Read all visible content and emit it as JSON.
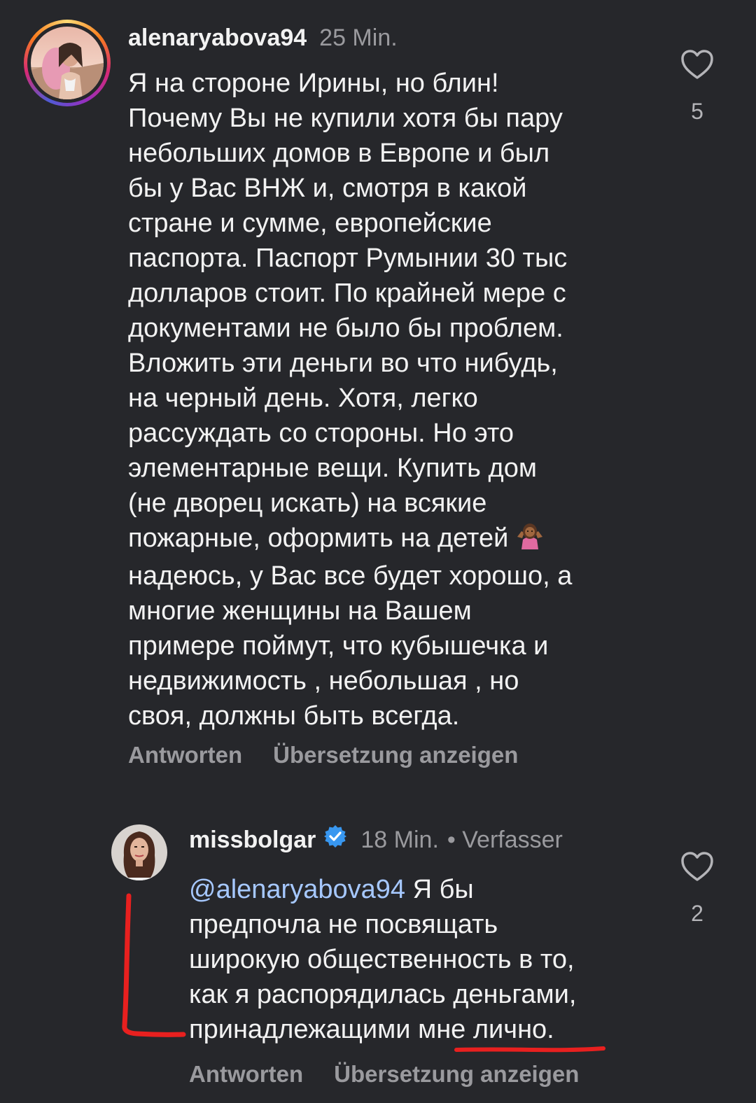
{
  "comments": [
    {
      "username": "alenaryabova94",
      "time": "25 Min.",
      "likes": "5",
      "lines": [
        "Я на стороне Ирины, но блин!",
        "Почему Вы не купили хотя бы пару",
        "небольших домов в Европе и был",
        "бы у Вас ВНЖ и, смотря в какой",
        "стране и сумме, европейские",
        "паспорта. Паспорт Румынии 30 тыс",
        "долларов стоит. По крайней мере с",
        "документами не было бы проблем.",
        "Вложить эти деньги во что нибудь,",
        "на черный день. Хотя, легко",
        "рассуждать со стороны. Но это",
        "элементарные вещи. Купить дом",
        "(не дворец искать) на всякие",
        "пожарные, оформить на детей",
        "надеюсь, у Вас все будет хорошо, а",
        "многие женщины на Вашем",
        "примере поймут, что кубышечка и",
        "недвижимость , небольшая , но",
        "своя, должны быть всегда."
      ],
      "reply_label": "Antworten",
      "translate_label": "Übersetzung anzeigen"
    },
    {
      "username": "missbolgar",
      "verified": true,
      "time": "18 Min.",
      "author_badge": "• Verfasser",
      "likes": "2",
      "mention": "@alenaryabova94",
      "first_line_rest": " Я бы",
      "lines": [
        "предпочла не посвящать",
        "широкую общественность в то,",
        "как я распорядилась деньгами,",
        "принадлежащими мне лично."
      ],
      "reply_label": "Antworten",
      "translate_label": "Übersetzung anzeigen"
    }
  ],
  "colors": {
    "background": "#26272b",
    "mention": "#a6c8ff",
    "verified": "#3897f0",
    "annotation": "#e8201f"
  },
  "icons": {
    "like": "heart-outline-icon",
    "verified": "verified-badge-icon",
    "emoji": "person-shrugging-emoji"
  }
}
